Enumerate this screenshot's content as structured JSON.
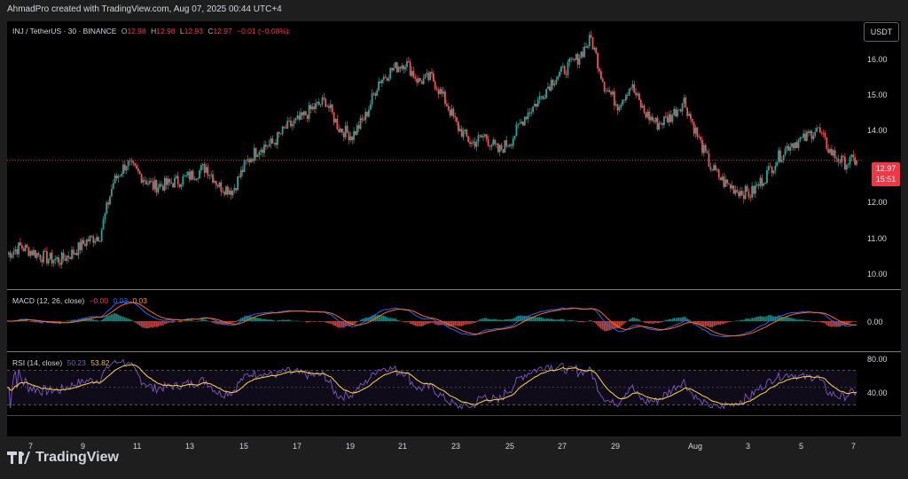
{
  "header": {
    "caption": "AhmadPro created with TradingView.com, Aug 07, 2025 00:44 UTC+4"
  },
  "symbol": {
    "title": "INJ / TetherUS · 30 · BINANCE",
    "open_label": "O",
    "open": "12.98",
    "high_label": "H",
    "high": "12.98",
    "low_label": "L",
    "low": "12.93",
    "close_label": "C",
    "close": "12.97",
    "change": "−0.01 (−0.08%)"
  },
  "currency_button": "USDT",
  "last_price": {
    "value": "12.97",
    "countdown": "15:51"
  },
  "price_axis": [
    "16.00",
    "15.00",
    "14.00",
    "13.00",
    "12.00",
    "11.00",
    "10.00"
  ],
  "macd": {
    "label": "MACD (12, 26, close)",
    "hist": "−0.00",
    "macd": "0.03",
    "signal": "0.03",
    "axis": [
      "0.00"
    ]
  },
  "rsi": {
    "label": "RSI (14, close)",
    "value": "50.23",
    "ma": "53.82",
    "axis": [
      "80.00",
      "40.00"
    ]
  },
  "date_axis": [
    "7",
    "9",
    "11",
    "13",
    "15",
    "17",
    "19",
    "21",
    "23",
    "25",
    "27",
    "29",
    "Aug",
    "3",
    "5",
    "7"
  ],
  "colors": {
    "up": "#26a69a",
    "down": "#ef5350",
    "macd_line": "#2962ff",
    "signal_line": "#ff6d00",
    "rsi_line": "#7e57c2",
    "rsi_ma": "#fdd835"
  },
  "brand": {
    "name": "TradingView"
  },
  "chart_data": {
    "type": "line",
    "price_series": [
      {
        "d": "Jul 7",
        "v": 10.55
      },
      {
        "d": "Jul 7.5",
        "v": 10.75
      },
      {
        "d": "Jul 8",
        "v": 10.6
      },
      {
        "d": "Jul 8.5",
        "v": 10.45
      },
      {
        "d": "Jul 9",
        "v": 10.4
      },
      {
        "d": "Jul 9.5",
        "v": 10.6
      },
      {
        "d": "Jul 10",
        "v": 10.9
      },
      {
        "d": "Jul 10.5",
        "v": 11.05
      },
      {
        "d": "Jul 11",
        "v": 12.4
      },
      {
        "d": "Jul 11.5",
        "v": 12.9
      },
      {
        "d": "Jul 12",
        "v": 12.6
      },
      {
        "d": "Jul 12.5",
        "v": 12.3
      },
      {
        "d": "Jul 13",
        "v": 12.35
      },
      {
        "d": "Jul 13.5",
        "v": 12.45
      },
      {
        "d": "Jul 14",
        "v": 12.6
      },
      {
        "d": "Jul 14.5",
        "v": 12.8
      },
      {
        "d": "Jul 15",
        "v": 12.3
      },
      {
        "d": "Jul 15.5",
        "v": 12.2
      },
      {
        "d": "Jul 16",
        "v": 12.9
      },
      {
        "d": "Jul 16.5",
        "v": 13.3
      },
      {
        "d": "Jul 17",
        "v": 13.4
      },
      {
        "d": "Jul 17.5",
        "v": 13.8
      },
      {
        "d": "Jul 18",
        "v": 14.0
      },
      {
        "d": "Jul 18.5",
        "v": 14.3
      },
      {
        "d": "Jul 19",
        "v": 14.5
      },
      {
        "d": "Jul 19.5",
        "v": 13.8
      },
      {
        "d": "Jul 20",
        "v": 13.6
      },
      {
        "d": "Jul 20.5",
        "v": 14.1
      },
      {
        "d": "Jul 21",
        "v": 15.0
      },
      {
        "d": "Jul 21.5",
        "v": 15.3
      },
      {
        "d": "Jul 22",
        "v": 15.5
      },
      {
        "d": "Jul 22.5",
        "v": 15.0
      },
      {
        "d": "Jul 23",
        "v": 15.1
      },
      {
        "d": "Jul 23.5",
        "v": 14.5
      },
      {
        "d": "Jul 24",
        "v": 13.8
      },
      {
        "d": "Jul 24.5",
        "v": 13.4
      },
      {
        "d": "Jul 25",
        "v": 13.6
      },
      {
        "d": "Jul 25.5",
        "v": 13.2
      },
      {
        "d": "Jul 26",
        "v": 13.5
      },
      {
        "d": "Jul 26.5",
        "v": 14.1
      },
      {
        "d": "Jul 27",
        "v": 14.5
      },
      {
        "d": "Jul 27.5",
        "v": 15.0
      },
      {
        "d": "Jul 28",
        "v": 15.3
      },
      {
        "d": "Jul 28.5",
        "v": 15.6
      },
      {
        "d": "Jul 29",
        "v": 16.1
      },
      {
        "d": "Jul 29.5",
        "v": 14.9
      },
      {
        "d": "Jul 30",
        "v": 14.4
      },
      {
        "d": "Jul 30.5",
        "v": 14.9
      },
      {
        "d": "Jul 31",
        "v": 14.2
      },
      {
        "d": "Jul 31.5",
        "v": 13.9
      },
      {
        "d": "Aug 1",
        "v": 14.1
      },
      {
        "d": "Aug 1.5",
        "v": 14.5
      },
      {
        "d": "Aug 2",
        "v": 13.6
      },
      {
        "d": "Aug 2.5",
        "v": 12.8
      },
      {
        "d": "Aug 3",
        "v": 12.4
      },
      {
        "d": "Aug 3.5",
        "v": 12.2
      },
      {
        "d": "Aug 4",
        "v": 12.1
      },
      {
        "d": "Aug 4.5",
        "v": 12.5
      },
      {
        "d": "Aug 5",
        "v": 13.0
      },
      {
        "d": "Aug 5.5",
        "v": 13.4
      },
      {
        "d": "Aug 6",
        "v": 13.5
      },
      {
        "d": "Aug 6.5",
        "v": 13.8
      },
      {
        "d": "Aug 7",
        "v": 13.2
      },
      {
        "d": "Aug 7.5",
        "v": 12.9
      },
      {
        "d": "Aug 8",
        "v": 12.97
      }
    ],
    "ylim": [
      9.7,
      16.5
    ]
  }
}
